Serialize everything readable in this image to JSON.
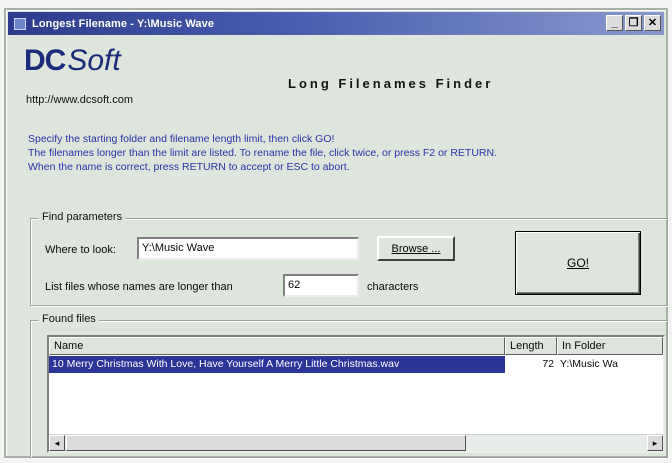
{
  "window": {
    "title": "Longest Filename - Y:\\Music Wave",
    "controls": {
      "minimize": "_",
      "restore": "❐",
      "close": "✕"
    }
  },
  "header": {
    "logo_dc": "DC",
    "logo_soft": "Soft",
    "url": "http://www.dcsoft.com",
    "app_title": "Long Filenames Finder"
  },
  "instructions": [
    "Specify the starting folder and filename length limit, then click GO!",
    "The filenames longer than the limit are listed.  To rename the file, click twice, or press F2 or RETURN.",
    "When the name is correct, press RETURN to accept or ESC to abort."
  ],
  "find_parameters": {
    "title": "Find parameters",
    "where_label": "Where to look:",
    "where_value": "Y:\\Music Wave",
    "browse_label": "Browse ...",
    "length_label": "List files whose names are longer than",
    "length_value": "62",
    "length_suffix": "characters",
    "go_label": "GO!"
  },
  "found_files": {
    "title": "Found files",
    "columns": [
      "Name",
      "Length",
      "In Folder"
    ],
    "rows": [
      {
        "name": "10 Merry Christmas With Love, Have Yourself A Merry Little Christmas.wav",
        "length": "72",
        "folder": "Y:\\Music Wa"
      }
    ],
    "scroll_left": "◂",
    "scroll_right": "▸"
  },
  "colors": {
    "titlebar": "#2c3b8c",
    "selection": "#2b3499",
    "instruction_text": "#2a32a8",
    "window_bg": "#dde5dd"
  }
}
